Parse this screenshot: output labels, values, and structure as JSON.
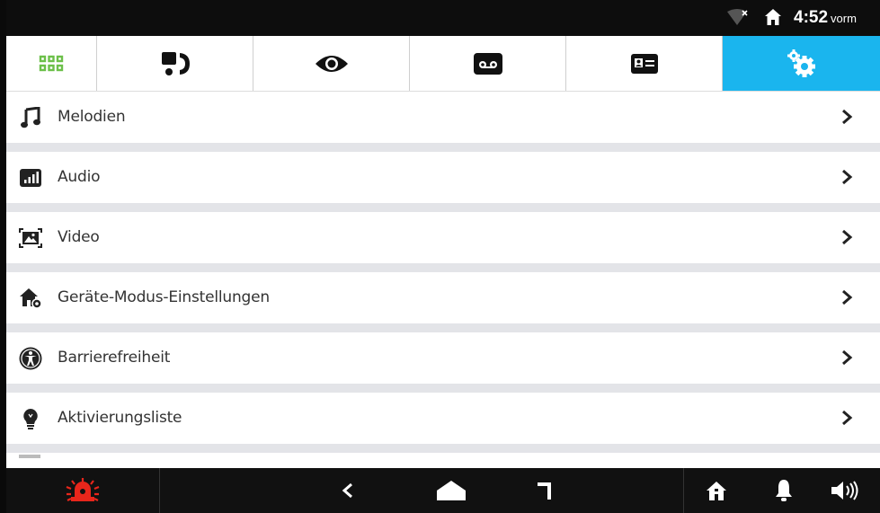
{
  "status_bar": {
    "time": "4:52",
    "time_suffix": "vorm",
    "icons": [
      "wifi-off-icon",
      "home-icon"
    ]
  },
  "tabs": [
    {
      "icon": "apps-grid-icon",
      "color": "#6cc04a",
      "active": false
    },
    {
      "icon": "intercom-call-icon",
      "active": false
    },
    {
      "icon": "eye-icon",
      "active": false
    },
    {
      "icon": "voicemail-icon",
      "active": false
    },
    {
      "icon": "contact-card-icon",
      "active": false
    },
    {
      "icon": "settings-gears-icon",
      "active": true,
      "color": "#1ab5ee"
    }
  ],
  "menu": {
    "items": [
      {
        "label": "Melodien",
        "icon": "music-note-icon"
      },
      {
        "label": "Audio",
        "icon": "audio-level-icon"
      },
      {
        "label": "Video",
        "icon": "video-frame-icon"
      },
      {
        "label": "Geräte-Modus-Einstellungen",
        "icon": "device-mode-icon"
      },
      {
        "label": "Barrierefreiheit",
        "icon": "accessibility-icon"
      },
      {
        "label": "Aktivierungsliste",
        "icon": "lightbulb-icon"
      }
    ]
  },
  "bottom_bar": {
    "icons": [
      "alarm-siren-icon",
      "back-icon",
      "home-nav-icon",
      "door-icon",
      "home-icon",
      "bell-icon",
      "volume-icon"
    ],
    "alarm_color": "#e8261b"
  }
}
